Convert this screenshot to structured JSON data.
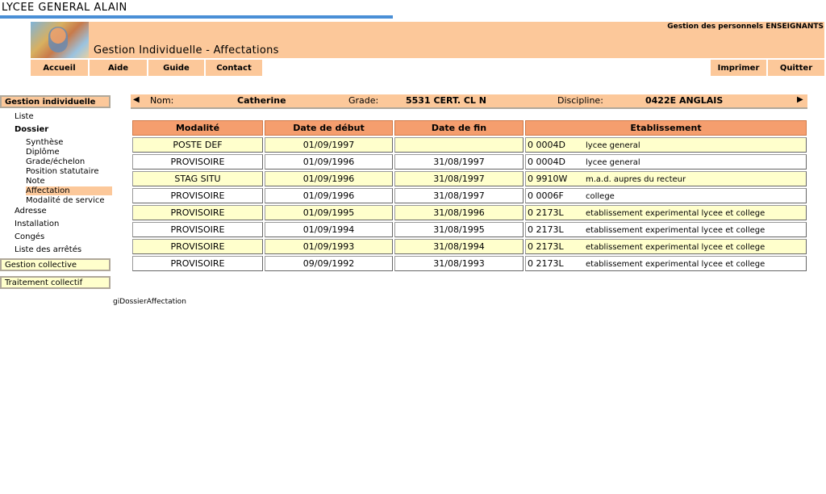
{
  "school": "LYCEE GENERAL ALAIN",
  "header": {
    "title": "Gestion Individuelle - Affectations",
    "corner": "Gestion des personnels ENSEIGNANTS"
  },
  "nav": {
    "accueil": "Accueil",
    "aide": "Aide",
    "guide": "Guide",
    "contact": "Contact",
    "imprimer": "Imprimer",
    "quitter": "Quitter"
  },
  "sidebar": {
    "gestion_individuelle": "Gestion individuelle",
    "liste": "Liste",
    "dossier": "Dossier",
    "dossier_items": [
      "Synthèse",
      "Diplôme",
      "Grade/échelon",
      "Position statutaire",
      "Note",
      "Affectation",
      "Modalité de service"
    ],
    "adresse": "Adresse",
    "installation": "Installation",
    "conges": "Congés",
    "liste_arretes": "Liste des arrêtés",
    "gestion_collective": "Gestion collective",
    "traitement_collectif": "Traitement collectif"
  },
  "person": {
    "nom_label": "Nom:",
    "nom": "Catherine",
    "grade_label": "Grade:",
    "grade": "5531 CERT. CL N",
    "discipline_label": "Discipline:",
    "discipline": "0422E ANGLAIS"
  },
  "table": {
    "headers": [
      "Modalité",
      "Date de début",
      "Date de fin",
      "Etablissement"
    ],
    "rows": [
      {
        "modalite": "POSTE DEF",
        "debut": "01/09/1997",
        "fin": "",
        "code": "0   0004D",
        "etab": "lycee general"
      },
      {
        "modalite": "PROVISOIRE",
        "debut": "01/09/1996",
        "fin": "31/08/1997",
        "code": "0   0004D",
        "etab": "lycee general"
      },
      {
        "modalite": "STAG SITU",
        "debut": "01/09/1996",
        "fin": "31/08/1997",
        "code": "0   9910W",
        "etab": "m.a.d. aupres du recteur"
      },
      {
        "modalite": "PROVISOIRE",
        "debut": "01/09/1996",
        "fin": "31/08/1997",
        "code": "0   0006F",
        "etab": "college"
      },
      {
        "modalite": "PROVISOIRE",
        "debut": "01/09/1995",
        "fin": "31/08/1996",
        "code": "0   2173L",
        "etab": "etablissement experimental lycee et college"
      },
      {
        "modalite": "PROVISOIRE",
        "debut": "01/09/1994",
        "fin": "31/08/1995",
        "code": "0   2173L",
        "etab": "etablissement experimental lycee et college"
      },
      {
        "modalite": "PROVISOIRE",
        "debut": "01/09/1993",
        "fin": "31/08/1994",
        "code": "0   2173L",
        "etab": "etablissement experimental lycee et college"
      },
      {
        "modalite": "PROVISOIRE",
        "debut": "09/09/1992",
        "fin": "31/08/1993",
        "code": "0   2173L",
        "etab": "etablissement experimental lycee et college"
      }
    ]
  },
  "footer": "giDossierAffectation"
}
